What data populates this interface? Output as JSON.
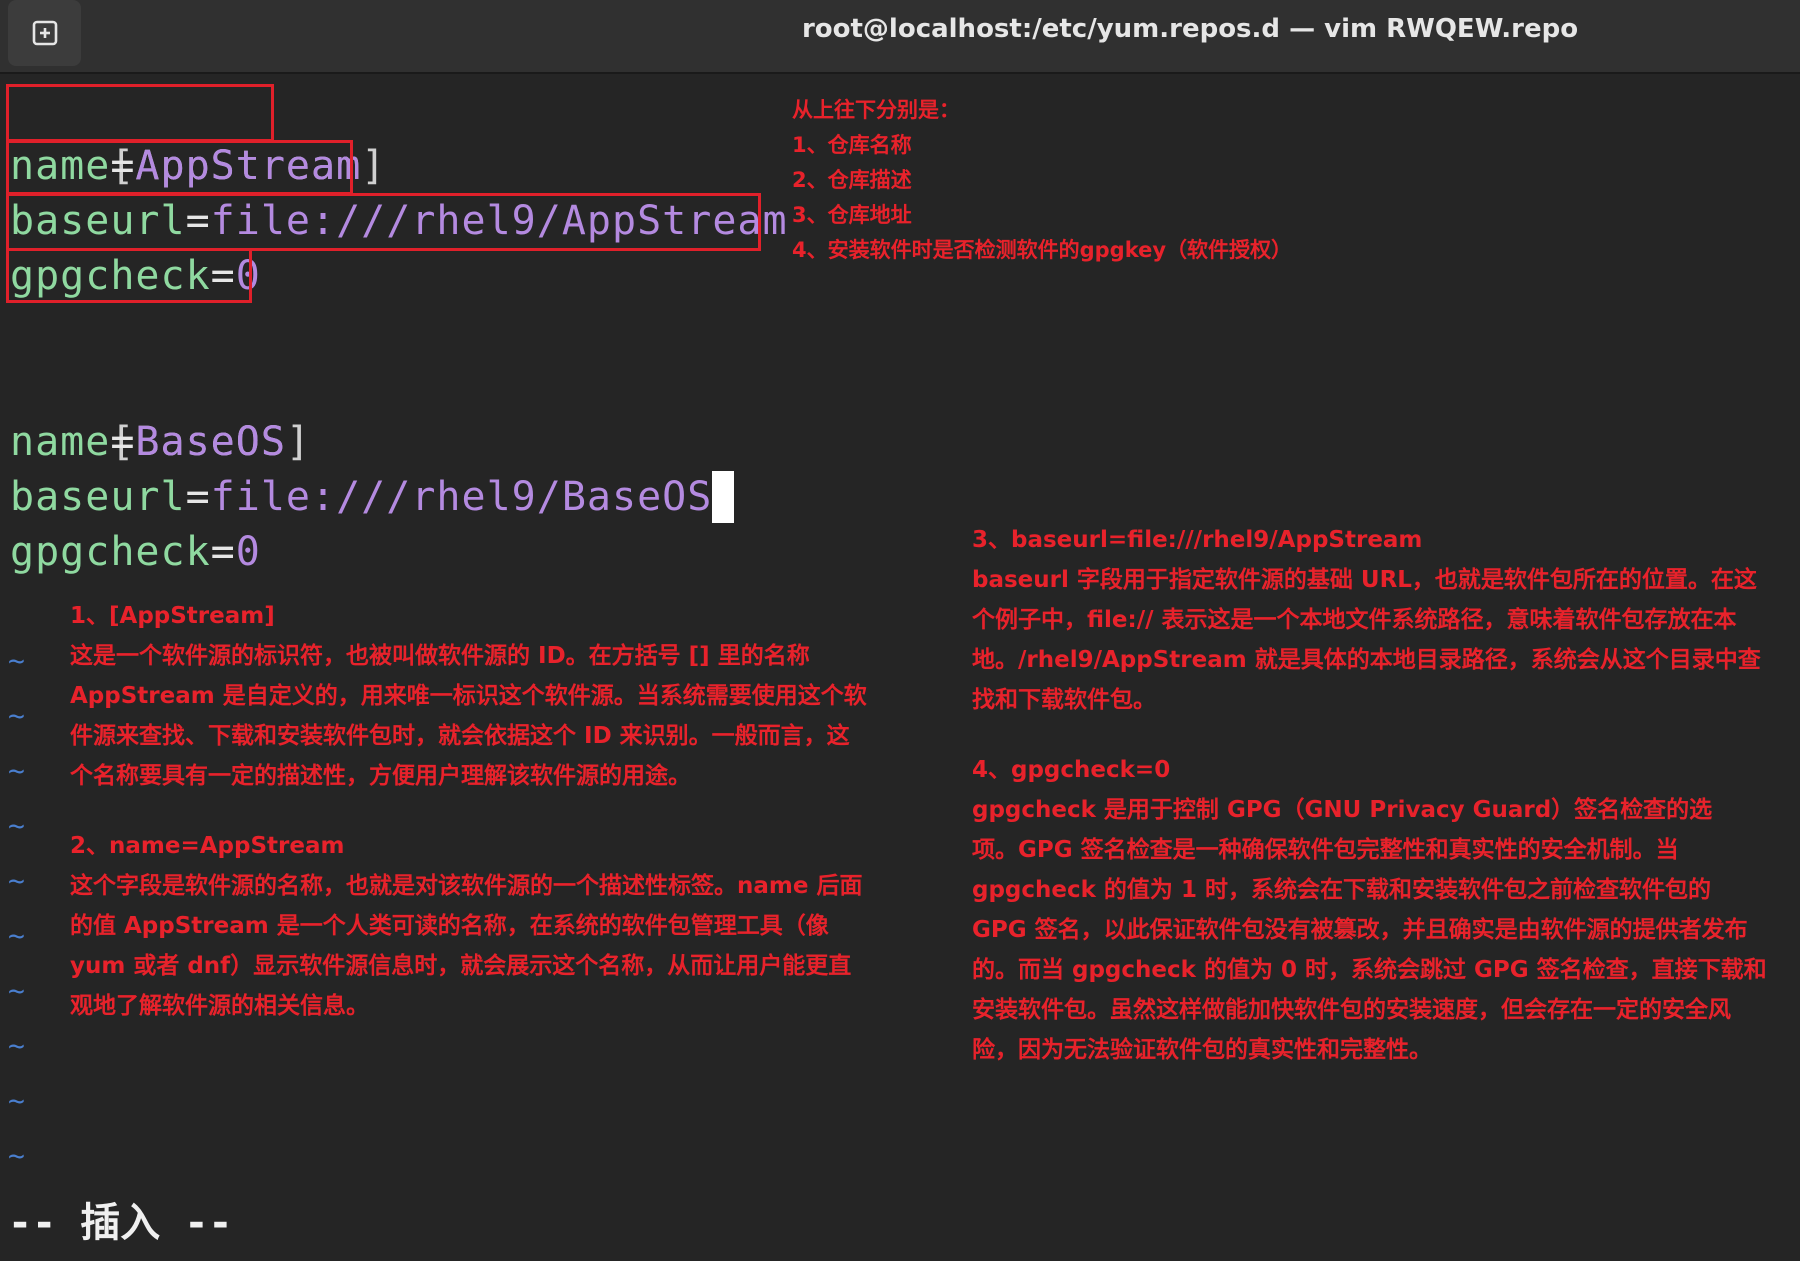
{
  "window": {
    "title": "root@localhost:/etc/yum.repos.d — vim RWQEW.repo",
    "new_tab_icon": "new-tab-icon"
  },
  "editor": {
    "lines": [
      {
        "header": "[AppStream]"
      },
      {
        "key": "name",
        "eq": "=",
        "value": "AppStream"
      },
      {
        "key": "baseurl",
        "eq": "=",
        "value": "file:///rhel9/AppStream"
      },
      {
        "key": "gpgcheck",
        "eq": "=",
        "value": "0"
      },
      {
        "header": "[BaseOS]"
      },
      {
        "key": "name",
        "eq": "=",
        "value": "BaseOS"
      },
      {
        "key": "baseurl",
        "eq": "=",
        "value": "file:///rhel9/BaseOS"
      },
      {
        "key": "gpgcheck",
        "eq": "=",
        "value": "0"
      }
    ],
    "tilde": "~",
    "mode": "-- 插入 --"
  },
  "annotations": {
    "list": [
      "从上往下分别是：",
      "1、仓库名称",
      "2、仓库描述",
      "3、仓库地址",
      "4、安装软件时是否检测软件的gpgkey（软件授权）"
    ],
    "p1": [
      "1、[AppStream]",
      "这是一个软件源的标识符，也被叫做软件源的 ID。在方括号 [] 里的名称",
      "AppStream 是自定义的，用来唯一标识这个软件源。当系统需要使用这个软",
      "件源来查找、下载和安装软件包时，就会依据这个 ID 来识别。一般而言，这",
      "个名称要具有一定的描述性，方便用户理解该软件源的用途。"
    ],
    "p2": [
      "2、name=AppStream",
      "这个字段是软件源的名称，也就是对该软件源的一个描述性标签。name 后面",
      "的值 AppStream 是一个人类可读的名称，在系统的软件包管理工具（像",
      "yum 或者 dnf）显示软件源信息时，就会展示这个名称，从而让用户能更直",
      "观地了解软件源的相关信息。"
    ],
    "p3": [
      "3、baseurl=file:///rhel9/AppStream",
      "baseurl 字段用于指定软件源的基础 URL，也就是软件包所在的位置。在这",
      "个例子中，file:// 表示这是一个本地文件系统路径，意味着软件包存放在本",
      "地。/rhel9/AppStream 就是具体的本地目录路径，系统会从这个目录中查",
      "找和下载软件包。"
    ],
    "p4": [
      "4、gpgcheck=0",
      "gpgcheck 是用于控制 GPG（GNU Privacy Guard）签名检查的选",
      "项。GPG 签名检查是一种确保软件包完整性和真实性的安全机制。当",
      "gpgcheck 的值为 1 时，系统会在下载和安装软件包之前检查软件包的",
      "GPG 签名，以此保证软件包没有被篡改，并且确实是由软件源的提供者发布",
      "的。而当 gpgcheck 的值为 0 时，系统会跳过 GPG 签名检查，直接下载和",
      "安装软件包。虽然这样做能加快软件包的安装速度，但会存在一定的安全风",
      "险，因为无法验证软件包的真实性和完整性。"
    ]
  },
  "colors": {
    "background": "#252525",
    "key": "#8fd9a0",
    "value": "#b48ae0",
    "annotation": "#e8222b",
    "tilde": "#4a7fcf"
  }
}
